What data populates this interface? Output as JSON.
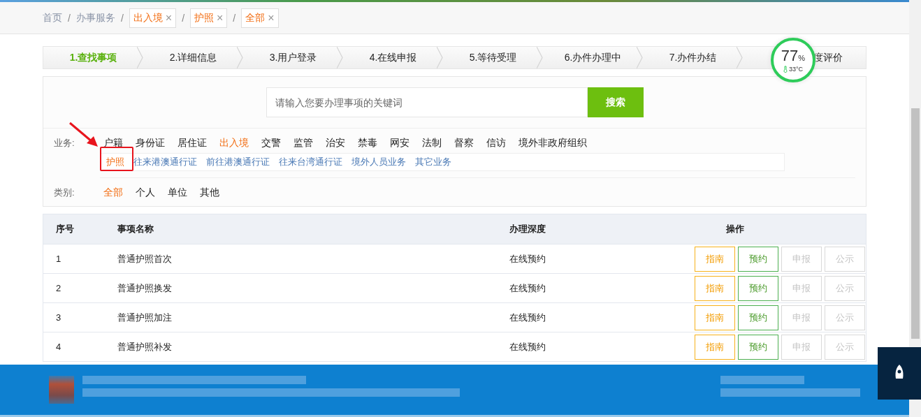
{
  "breadcrumb": {
    "links": [
      "首页",
      "办事服务"
    ],
    "tags": [
      "出入境",
      "护照",
      "全部"
    ],
    "tag_close": "×",
    "separator": "/"
  },
  "steps": [
    {
      "label": "1.查找事项",
      "selected": true
    },
    {
      "label": "2.详细信息",
      "selected": false
    },
    {
      "label": "3.用户登录",
      "selected": false
    },
    {
      "label": "4.在线申报",
      "selected": false
    },
    {
      "label": "5.等待受理",
      "selected": false
    },
    {
      "label": "6.办件办理中",
      "selected": false
    },
    {
      "label": "7.办件办结",
      "selected": false
    },
    {
      "label": "度评价",
      "selected": false
    }
  ],
  "widget": {
    "percent": "77",
    "unit": "%",
    "temperature": "33°C"
  },
  "search": {
    "placeholder": "请输入您要办理事项的关键词",
    "button": "搜索"
  },
  "business": {
    "label": "业务:",
    "items": [
      {
        "label": "户籍",
        "selected": false
      },
      {
        "label": "身份证",
        "selected": false
      },
      {
        "label": "居住证",
        "selected": false
      },
      {
        "label": "出入境",
        "selected": true
      },
      {
        "label": "交警",
        "selected": false
      },
      {
        "label": "监管",
        "selected": false
      },
      {
        "label": "治安",
        "selected": false
      },
      {
        "label": "禁毒",
        "selected": false
      },
      {
        "label": "网安",
        "selected": false
      },
      {
        "label": "法制",
        "selected": false
      },
      {
        "label": "督察",
        "selected": false
      },
      {
        "label": "信访",
        "selected": false
      },
      {
        "label": "境外非政府组织",
        "selected": false
      }
    ],
    "sub_items": [
      {
        "label": "护照",
        "selected": true
      },
      {
        "label": "往来港澳通行证",
        "selected": false
      },
      {
        "label": "前往港澳通行证",
        "selected": false
      },
      {
        "label": "往来台湾通行证",
        "selected": false
      },
      {
        "label": "境外人员业务",
        "selected": false
      },
      {
        "label": "其它业务",
        "selected": false
      }
    ]
  },
  "category": {
    "label": "类别:",
    "items": [
      {
        "label": "全部",
        "selected": true
      },
      {
        "label": "个人",
        "selected": false
      },
      {
        "label": "单位",
        "selected": false
      },
      {
        "label": "其他",
        "selected": false
      }
    ]
  },
  "table": {
    "columns": [
      "序号",
      "事项名称",
      "办理深度",
      "操作"
    ],
    "rows": [
      {
        "no": "1",
        "name": "普通护照首次",
        "depth": "在线预约",
        "actions": [
          {
            "kind": "guide",
            "label": "指南",
            "disabled": false
          },
          {
            "kind": "book",
            "label": "预约",
            "disabled": false
          },
          {
            "kind": "plain",
            "label": "申报",
            "disabled": true
          },
          {
            "kind": "plain",
            "label": "公示",
            "disabled": true
          }
        ]
      },
      {
        "no": "2",
        "name": "普通护照换发",
        "depth": "在线预约",
        "actions": [
          {
            "kind": "guide",
            "label": "指南",
            "disabled": false
          },
          {
            "kind": "book",
            "label": "预约",
            "disabled": false
          },
          {
            "kind": "plain",
            "label": "申报",
            "disabled": true
          },
          {
            "kind": "plain",
            "label": "公示",
            "disabled": true
          }
        ]
      },
      {
        "no": "3",
        "name": "普通护照加注",
        "depth": "在线预约",
        "actions": [
          {
            "kind": "guide",
            "label": "指南",
            "disabled": false
          },
          {
            "kind": "book",
            "label": "预约",
            "disabled": false
          },
          {
            "kind": "plain",
            "label": "申报",
            "disabled": true
          },
          {
            "kind": "plain",
            "label": "公示",
            "disabled": true
          }
        ]
      },
      {
        "no": "4",
        "name": "普通护照补发",
        "depth": "在线预约",
        "actions": [
          {
            "kind": "guide",
            "label": "指南",
            "disabled": false
          },
          {
            "kind": "book",
            "label": "预约",
            "disabled": false
          },
          {
            "kind": "plain",
            "label": "申报",
            "disabled": true
          },
          {
            "kind": "plain",
            "label": "公示",
            "disabled": true
          }
        ]
      }
    ]
  }
}
